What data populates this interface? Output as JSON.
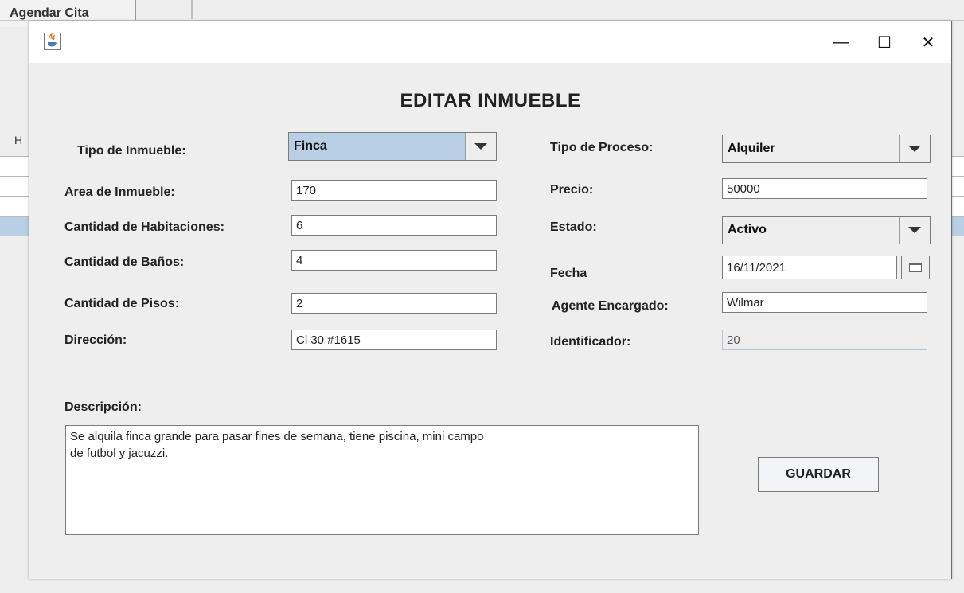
{
  "background": {
    "tab_label": "Agendar Cita",
    "left_fragment": "H"
  },
  "dialog": {
    "title": "EDITAR INMUEBLE",
    "window_controls": {
      "minimize": "—",
      "maximize": "☐",
      "close": "✕"
    },
    "left_form": {
      "tipo_inmueble_label": "Tipo de Inmueble:",
      "tipo_inmueble_value": "Finca",
      "area_label": "Area de Inmueble:",
      "area_value": "170",
      "habitaciones_label": "Cantidad de Habitaciones:",
      "habitaciones_value": "6",
      "banos_label": "Cantidad de Baños:",
      "banos_value": "4",
      "pisos_label": "Cantidad de Pisos:",
      "pisos_value": "2",
      "direccion_label": "Dirección:",
      "direccion_value": "Cl 30 #1615"
    },
    "right_form": {
      "proceso_label": "Tipo de Proceso:",
      "proceso_value": "Alquiler",
      "precio_label": "Precio:",
      "precio_value": "50000",
      "estado_label": "Estado:",
      "estado_value": "Activo",
      "fecha_label": "Fecha",
      "fecha_value": "16/11/2021",
      "agente_label": "Agente Encargado:",
      "agente_value": "Wilmar",
      "identificador_label": "Identificador:",
      "identificador_value": "20"
    },
    "descripcion_label": "Descripción:",
    "descripcion_value": "Se alquila finca grande para pasar fines de semana, tiene piscina, mini campo\nde futbol y jacuzzi.",
    "save_label": "GUARDAR"
  },
  "colors": {
    "selected_combo": "#b8cfe5",
    "window_background": "#eeeeee"
  },
  "icons": {
    "app_icon": "java-app-icon",
    "dropdown": "triangle-down-icon",
    "calendar": "calendar-icon"
  }
}
